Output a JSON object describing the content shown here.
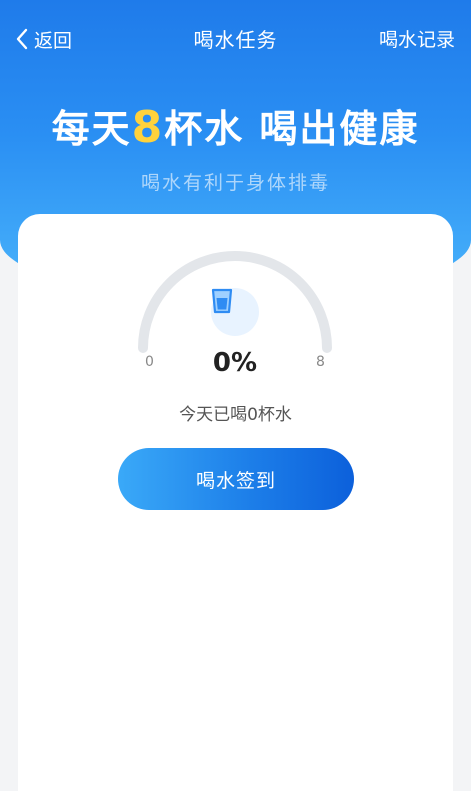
{
  "nav": {
    "back_label": "返回",
    "title": "喝水任务",
    "record_label": "喝水记录"
  },
  "hero": {
    "slogan_prefix": "每天",
    "slogan_number": "8",
    "slogan_suffix": "杯水 喝出健康",
    "subtitle": "喝水有利于身体排毒"
  },
  "progress": {
    "min": "0",
    "max": "8",
    "percent_text": "0%",
    "fraction": 0,
    "status_text": "今天已喝0杯水"
  },
  "actions": {
    "checkin_label": "喝水签到"
  },
  "colors": {
    "primary": "#1f7bea",
    "accent_number": "#ffd23c",
    "gauge_track": "#e3e6ea",
    "cup_icon": "#2f8cf3"
  },
  "icons": {
    "back": "chevron-left-icon",
    "cup": "water-cup-icon"
  }
}
